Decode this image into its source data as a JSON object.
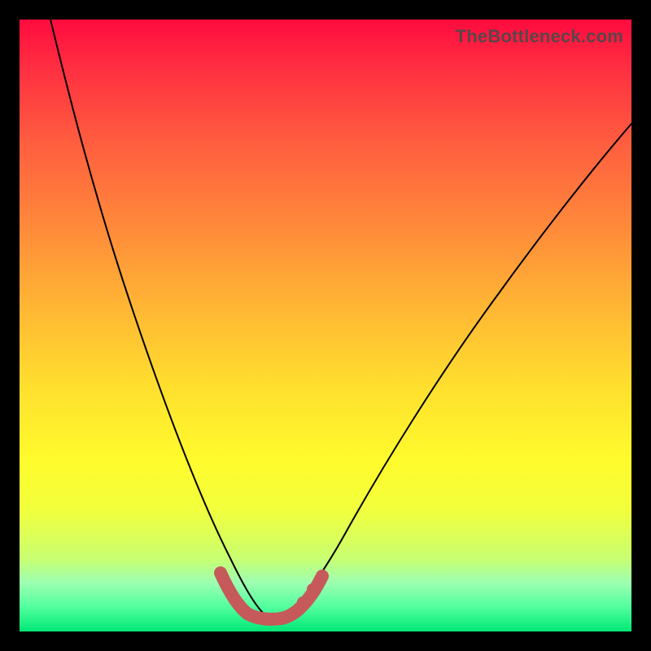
{
  "watermark": "TheBottleneck.com",
  "chart_data": {
    "type": "line",
    "title": "",
    "xlabel": "",
    "ylabel": "",
    "xlim": [
      0,
      100
    ],
    "ylim": [
      0,
      100
    ],
    "series": [
      {
        "name": "bottleneck-curve",
        "x": [
          0,
          5,
          10,
          15,
          20,
          25,
          30,
          33,
          36,
          38,
          42,
          45,
          48,
          52,
          58,
          66,
          74,
          82,
          90,
          100
        ],
        "values": [
          100,
          87,
          74,
          61,
          48,
          35,
          22,
          12,
          5,
          2,
          2,
          4,
          8,
          14,
          24,
          37,
          49,
          60,
          70,
          82
        ]
      },
      {
        "name": "sweet-spot-band",
        "x": [
          32,
          34,
          36,
          38,
          40,
          42,
          44,
          46
        ],
        "values": [
          8,
          5,
          3,
          2,
          2,
          3,
          4,
          6
        ]
      }
    ],
    "colors": {
      "curve": "#000000",
      "band": "#c65a5a"
    }
  }
}
